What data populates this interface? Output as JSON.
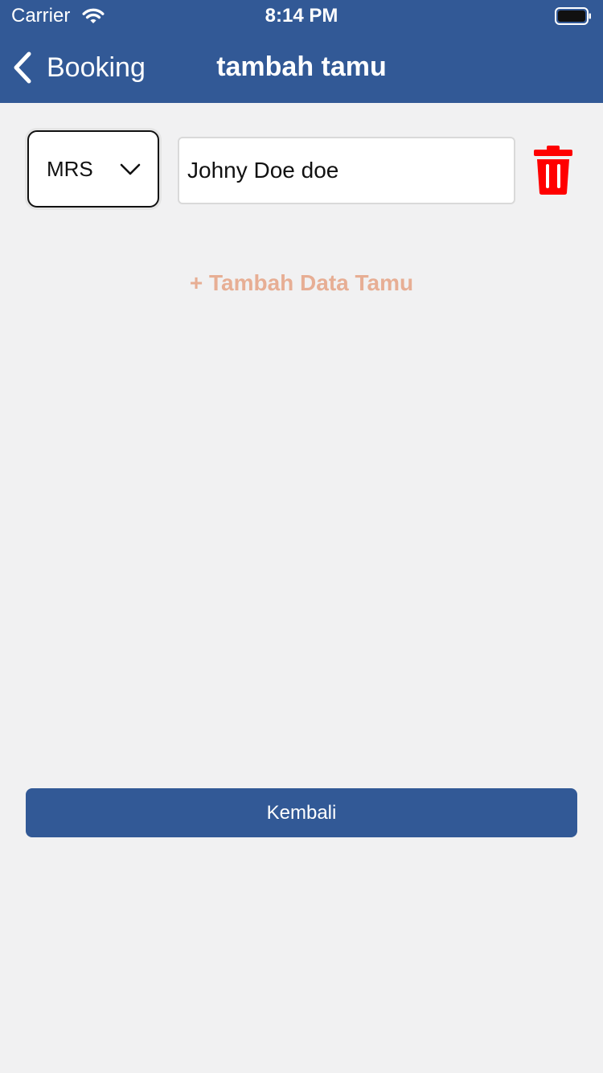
{
  "status_bar": {
    "carrier": "Carrier",
    "time": "8:14 PM",
    "icons": [
      "wifi-icon",
      "battery-icon"
    ]
  },
  "nav_bar": {
    "back_label": "Booking",
    "title": "tambah tamu",
    "icons": [
      "chevron-left-icon"
    ],
    "color": "#325996"
  },
  "guest_form": {
    "guests": [
      {
        "salutation": "MRS",
        "name": "Johny Doe doe"
      }
    ],
    "icons": [
      "chevron-down-icon",
      "trash-icon"
    ],
    "delete_color": "#ff0000",
    "add_guest_label": "+ Tambah Data Tamu",
    "add_guest_color": "#e7ae94"
  },
  "footer": {
    "back_button_label": "Kembali",
    "button_color": "#325996"
  }
}
